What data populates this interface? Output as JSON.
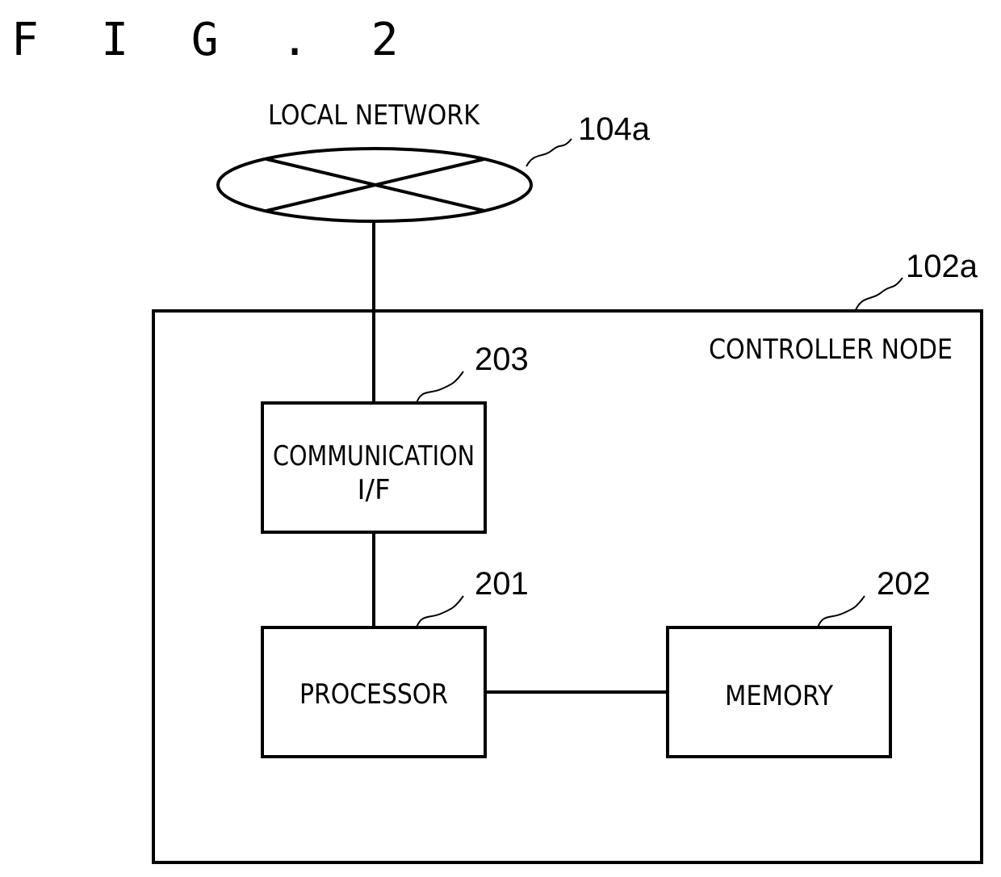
{
  "figure": {
    "title": "F I G . 2"
  },
  "network": {
    "label": "LOCAL NETWORK",
    "ref": "104a"
  },
  "node": {
    "label": "CONTROLLER NODE",
    "ref": "102a"
  },
  "blocks": {
    "comm": {
      "line1": "COMMUNICATION",
      "line2": "I/F",
      "ref": "203"
    },
    "processor": {
      "label": "PROCESSOR",
      "ref": "201"
    },
    "memory": {
      "label": "MEMORY",
      "ref": "202"
    }
  },
  "text_color": "#000000",
  "background": "#ffffff"
}
